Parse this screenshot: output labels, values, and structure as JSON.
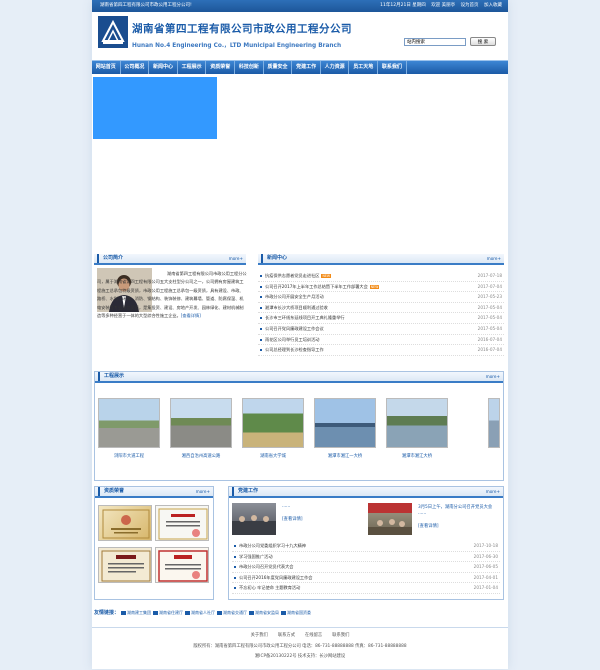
{
  "topbar": {
    "welcome": "湖南省第四工程有限公司市政公用工程分公司!",
    "date": "11年12月21日 星期四",
    "welcome2": "欢迎 美丽亭",
    "set_home": "设为首页",
    "add_fav": "加入收藏"
  },
  "header": {
    "company_name": "湖南省第四工程有限公司市政公用工程分公司",
    "english_name": "Hunan No.4 Engineering Co.，LTD Municipal Engineering Branch",
    "search_placeholder": "站内搜索",
    "search_button": "搜 索"
  },
  "nav": [
    "网站首页",
    "公司概况",
    "新闻中心",
    "工程展示",
    "资质荣誉",
    "科技创新",
    "质量安全",
    "党建工作",
    "人力资源",
    "员工天地",
    "联系我们"
  ],
  "intro": {
    "title": "公司简介",
    "more": "more+",
    "text": "湖南省第四工程有限公司市政公用工程分公司，属于湖南省第四工程有限公司五大支柱型分公司之一，公司拥有房屋建筑工程施工总承包特级资质，市政公用工程施工总承包一级资质，具有建设、市政、路桥、水利、环保、消防、钢结构、装饰装修、建筑幕墙、管道、防腐保温、机电安装等专业承包资质，是集投资、建设、房地产开发、园林绿化、建材机械制造等多种经营于一体的大型综合性施工企业。",
    "more_link": "[查看详情]"
  },
  "news": {
    "title": "新闻中心",
    "more": "more+",
    "new_badge": "NEW",
    "items": [
      {
        "title": "抗疫保供志愿者党员走进社区",
        "date": "2017-07-18",
        "isnew": true
      },
      {
        "title": "公司召开2017年上半年工作总结暨下半年工作部署大会",
        "date": "2017-07-04",
        "isnew": true
      },
      {
        "title": "市政分公司开展安全生产月活动",
        "date": "2017-05-23",
        "isnew": false
      },
      {
        "title": "湘潭市长沙大桥项目顺利通过验收",
        "date": "2017-05-04",
        "isnew": false
      },
      {
        "title": "长沙市三环线东延线项目开工典礼隆重举行",
        "date": "2017-05-04",
        "isnew": false
      },
      {
        "title": "公司召开党风廉政建设工作会议",
        "date": "2017-05-04",
        "isnew": false
      },
      {
        "title": "雨花区公司举行员工培训活动",
        "date": "2016-07-04",
        "isnew": false
      },
      {
        "title": "公司总经理到长沙检查指导工作",
        "date": "2016-07-04",
        "isnew": false
      }
    ]
  },
  "projects": {
    "title": "工程展示",
    "more": "more+",
    "items": [
      "浏阳市大道工程",
      "湘西自治州高速公路",
      "湖南省大学城",
      "湘潭市湘江一大桥",
      "湘潭市湘江大桥"
    ]
  },
  "honors": {
    "title": "资质荣誉",
    "more": "more+"
  },
  "party": {
    "title": "党建工作",
    "more": "more+",
    "feature1_title": "······",
    "feature1_more": "[查看详情]",
    "feature2_title": "3月5日上午，湖南分公司召开党员大会······",
    "feature2_more": "[查看详情]",
    "items": [
      {
        "title": "市政分公司党委组织学习十九大精神",
        "date": "2017-10-18"
      },
      {
        "title": "学习强国推广活动",
        "date": "2017-06-30"
      },
      {
        "title": "市政分公司召开党员代表大会",
        "date": "2017-06-05"
      },
      {
        "title": "公司召开2016年度党风廉政建设工作会",
        "date": "2017-04-01"
      },
      {
        "title": "不忘初心 牢记使命 主题教育活动",
        "date": "2017-01-04"
      }
    ]
  },
  "links": {
    "label": "友情链接：",
    "items": [
      "湖南建工集团",
      "湖南省住建厅",
      "湖南省人社厅",
      "湖南省交通厅",
      "湖南省安监局",
      "湖南省国资委"
    ]
  },
  "footer": {
    "links": [
      "关于我们",
      "联系方式",
      "在线留言",
      "联系我们"
    ],
    "copyright": "版权所有：湖南省第四工程有限公司市政公用工程分公司 电话：86-731-88888888 传真：86-731-88888888",
    "icp": "湘ICP备20130222号 技术支持：长沙网站建设"
  },
  "colors": {
    "brand": "#1a5ba8",
    "nav": "#2a6fc0",
    "banner": "#3399ff"
  }
}
